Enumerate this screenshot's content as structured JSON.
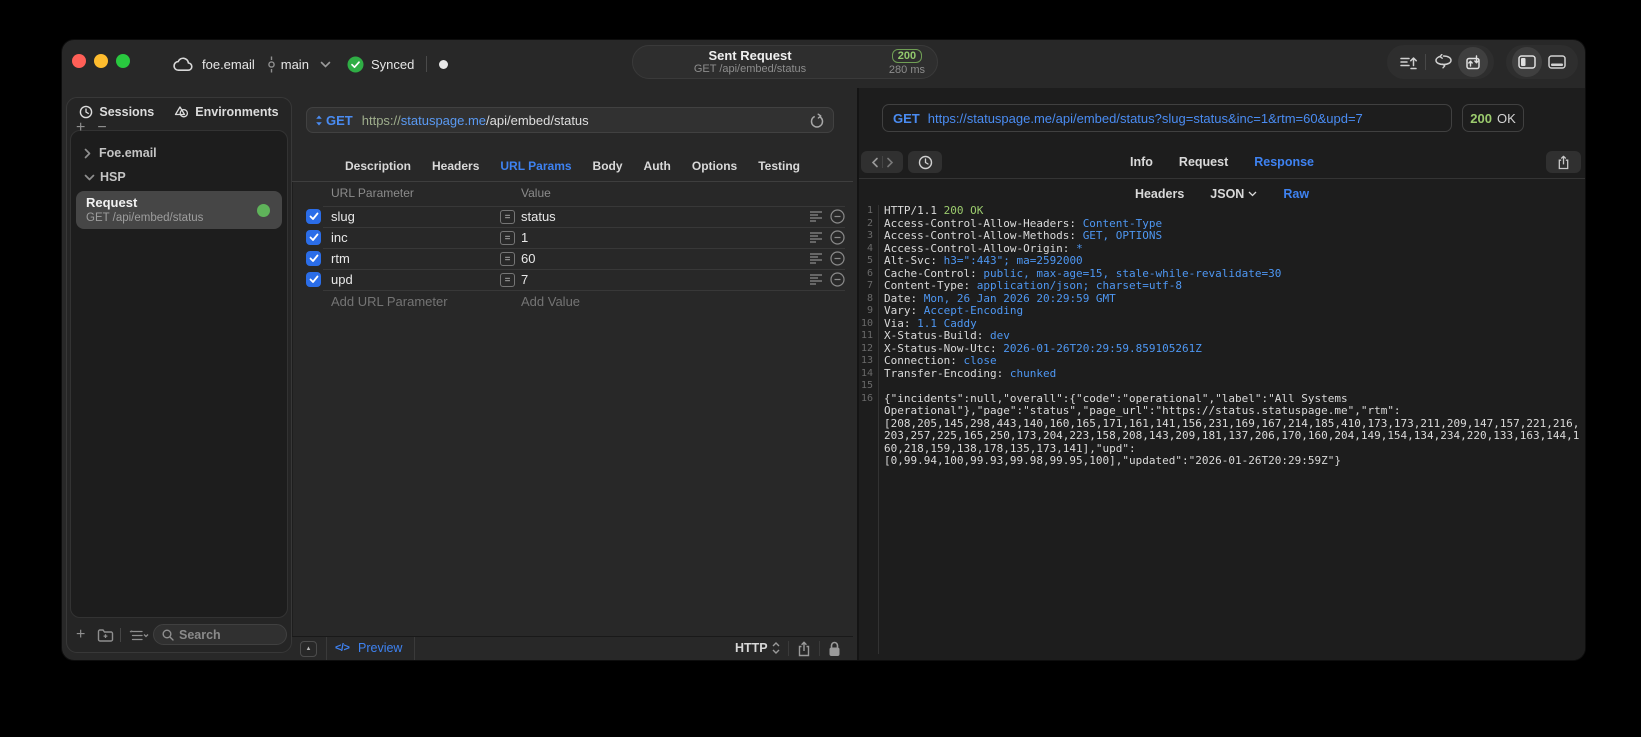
{
  "titlebar": {
    "project": "foe.email",
    "branch": "main",
    "sync_label": "Synced",
    "center": {
      "title": "Sent Request",
      "subtitle": "GET /api/embed/status",
      "status_code": "200",
      "duration": "280 ms"
    }
  },
  "sidebar": {
    "tabs": [
      {
        "label": "Sessions"
      },
      {
        "label": "Environments"
      }
    ],
    "tree": [
      {
        "label": "Foe.email",
        "expanded": false
      },
      {
        "label": "HSP",
        "expanded": true
      }
    ],
    "request_item": {
      "title": "Request",
      "subtitle": "GET /api/embed/status"
    },
    "search_placeholder": "Search"
  },
  "editor": {
    "method": "GET",
    "url": {
      "scheme": "https://",
      "host": "statuspage.me",
      "path": "/api/embed/status"
    },
    "tabs": [
      "Description",
      "Headers",
      "URL Params",
      "Body",
      "Auth",
      "Options",
      "Testing"
    ],
    "active_tab": "URL Params",
    "param_table": {
      "col_param": "URL Parameter",
      "col_value": "Value",
      "rows": [
        {
          "name": "slug",
          "value": "status",
          "checked": true
        },
        {
          "name": "inc",
          "value": "1",
          "checked": true
        },
        {
          "name": "rtm",
          "value": "60",
          "checked": true
        },
        {
          "name": "upd",
          "value": "7",
          "checked": true
        }
      ],
      "add_param": "Add URL Parameter",
      "add_value": "Add Value"
    },
    "footer": {
      "preview_label": "Preview",
      "protocol": "HTTP"
    }
  },
  "response": {
    "method": "GET",
    "url": "https://statuspage.me/api/embed/status?slug=status&inc=1&rtm=60&upd=7",
    "status_code": "200",
    "status_text": "OK",
    "tabs": [
      "Info",
      "Request",
      "Response"
    ],
    "active_tab": "Response",
    "subtabs": [
      "Headers",
      "JSON",
      "Raw"
    ],
    "active_subtab": "Raw",
    "http_version": "HTTP/1.1",
    "status_line": "200 OK",
    "headers": [
      {
        "name": "Access-Control-Allow-Headers",
        "value": "Content-Type"
      },
      {
        "name": "Access-Control-Allow-Methods",
        "value": "GET, OPTIONS"
      },
      {
        "name": "Access-Control-Allow-Origin",
        "value": "*"
      },
      {
        "name": "Alt-Svc",
        "value": "h3=\":443\"; ma=2592000"
      },
      {
        "name": "Cache-Control",
        "value": "public, max-age=15, stale-while-revalidate=30"
      },
      {
        "name": "Content-Type",
        "value": "application/json; charset=utf-8"
      },
      {
        "name": "Date",
        "value": "Mon, 26 Jan 2026 20:29:59 GMT"
      },
      {
        "name": "Vary",
        "value": "Accept-Encoding"
      },
      {
        "name": "Via",
        "value": "1.1 Caddy"
      },
      {
        "name": "X-Status-Build",
        "value": "dev"
      },
      {
        "name": "X-Status-Now-Utc",
        "value": "2026-01-26T20:29:59.859105261Z"
      },
      {
        "name": "Connection",
        "value": "close"
      },
      {
        "name": "Transfer-Encoding",
        "value": "chunked"
      }
    ],
    "body_lines": [
      "{\"incidents\":null,\"overall\":{\"code\":\"operational\",\"label\":\"All Systems",
      "Operational\"},\"page\":\"status\",\"page_url\":\"https://status.statuspage.me\",\"rtm\":",
      "[208,205,145,298,443,140,160,165,171,161,141,156,231,169,167,214,185,410,173,173,211,209,147,157,221,216,",
      "203,257,225,165,250,173,204,223,158,208,143,209,181,137,206,170,160,204,149,154,134,234,220,133,163,144,1",
      "60,218,159,138,178,135,173,141],\"upd\":",
      "[0,99.94,100,99.93,99.98,99.95,100],\"updated\":\"2026-01-26T20:29:59Z\"}"
    ]
  },
  "colors": {
    "accent_blue": "#3e82f1",
    "value_blue": "#4e97f2",
    "green": "#9bcb6d",
    "dot_green": "#5fb35a"
  }
}
